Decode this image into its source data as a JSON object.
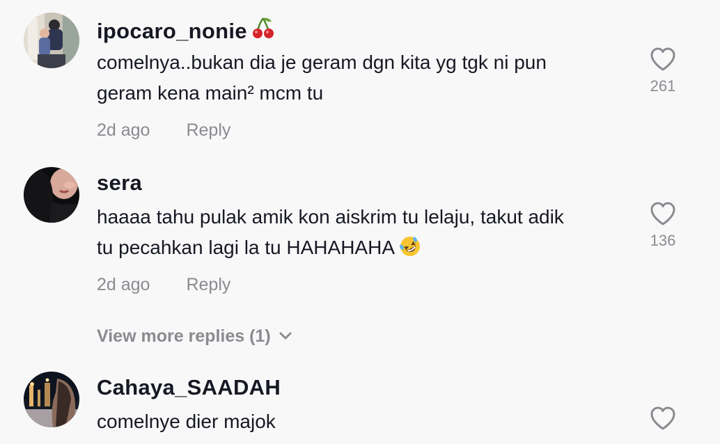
{
  "comments": [
    {
      "username": "ipocaro_nonie",
      "username_emoji": "cherry-emoji",
      "text_lines": [
        "comelnya..bukan dia je geram dgn kita yg tgk ni pun",
        "geram kena main² mcm tu"
      ],
      "time": "2d ago",
      "reply_label": "Reply",
      "likes": "261",
      "like_icon": "heart-outline-icon"
    },
    {
      "username": "sera",
      "text_lines": [
        "haaaa tahu pulak amik kon aiskrim tu lelaju, takut adik",
        "tu pecahkan lagi la tu HAHAHAHA"
      ],
      "text_emoji": "rolling-on-floor-laughing-emoji",
      "time": "2d ago",
      "reply_label": "Reply",
      "likes": "136",
      "like_icon": "heart-outline-icon"
    },
    {
      "username": "Cahaya_SAADAH",
      "text_lines": [
        "comelnye dier majok"
      ],
      "like_icon": "heart-outline-icon"
    }
  ],
  "view_more_replies": "View more replies (1)",
  "colors": {
    "background": "#f8f8f8",
    "primary_text": "#161823",
    "secondary_text": "#8a8b91"
  }
}
